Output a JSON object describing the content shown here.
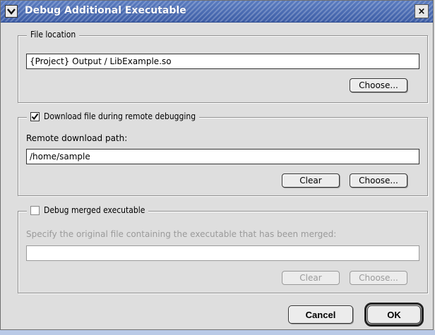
{
  "window": {
    "title": "Debug Additional Executable"
  },
  "file_location": {
    "label": "File location",
    "value": "{Project} Output / LibExample.so",
    "choose_label": "Choose..."
  },
  "download": {
    "label": "Download file during remote debugging",
    "checked": true,
    "path_label": "Remote download path:",
    "path_value": "/home/sample",
    "clear_label": "Clear",
    "choose_label": "Choose..."
  },
  "merged": {
    "label": "Debug merged executable",
    "checked": false,
    "desc": "Specify the original file containing the executable that has been merged:",
    "value": "",
    "clear_label": "Clear",
    "choose_label": "Choose..."
  },
  "actions": {
    "cancel_label": "Cancel",
    "ok_label": "OK"
  }
}
